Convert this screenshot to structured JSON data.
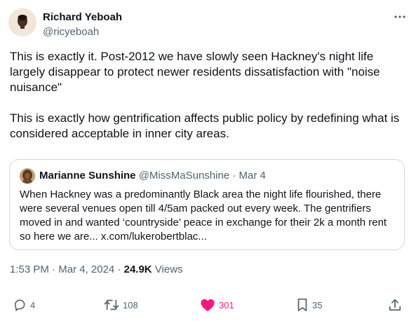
{
  "author": {
    "name": "Richard Yeboah",
    "handle": "@ricyeboah"
  },
  "tweet": {
    "text": "This is exactly it. Post-2012 we have slowly seen Hackney's night life largely disappear to protect newer residents dissatisfaction with \"noise nuisance\"\n\nThis is exactly how gentrification affects public policy by redefining what is considered acceptable in inner city areas."
  },
  "quote": {
    "name": "Marianne Sunshine",
    "handle": "@MissMaSunshine",
    "separator": " · ",
    "date": "Mar 4",
    "text": "When Hackney was a predominantly Black area the night life flourished, there were several venues open till 4/5am packed out every week. The gentrifiers moved in and wanted ‘countryside’ peace in exchange for their 2k a month rent  so here we are... x.com/lukerobertblac..."
  },
  "meta": {
    "time": "1:53 PM",
    "separator": " · ",
    "date": "Mar 4, 2024",
    "separator2": " · ",
    "views_count": "24.9K",
    "views_label": " Views"
  },
  "actions": {
    "replies": "4",
    "reposts": "108",
    "likes": "301",
    "bookmarks": "35"
  },
  "icons": {
    "more": "more-dots-icon",
    "reply": "reply-icon",
    "repost": "repost-icon",
    "like": "heart-filled-icon",
    "bookmark": "bookmark-icon",
    "share": "share-icon"
  },
  "colors": {
    "like_active": "#f91880",
    "secondary_text": "#536471",
    "border": "#cfd9de"
  }
}
